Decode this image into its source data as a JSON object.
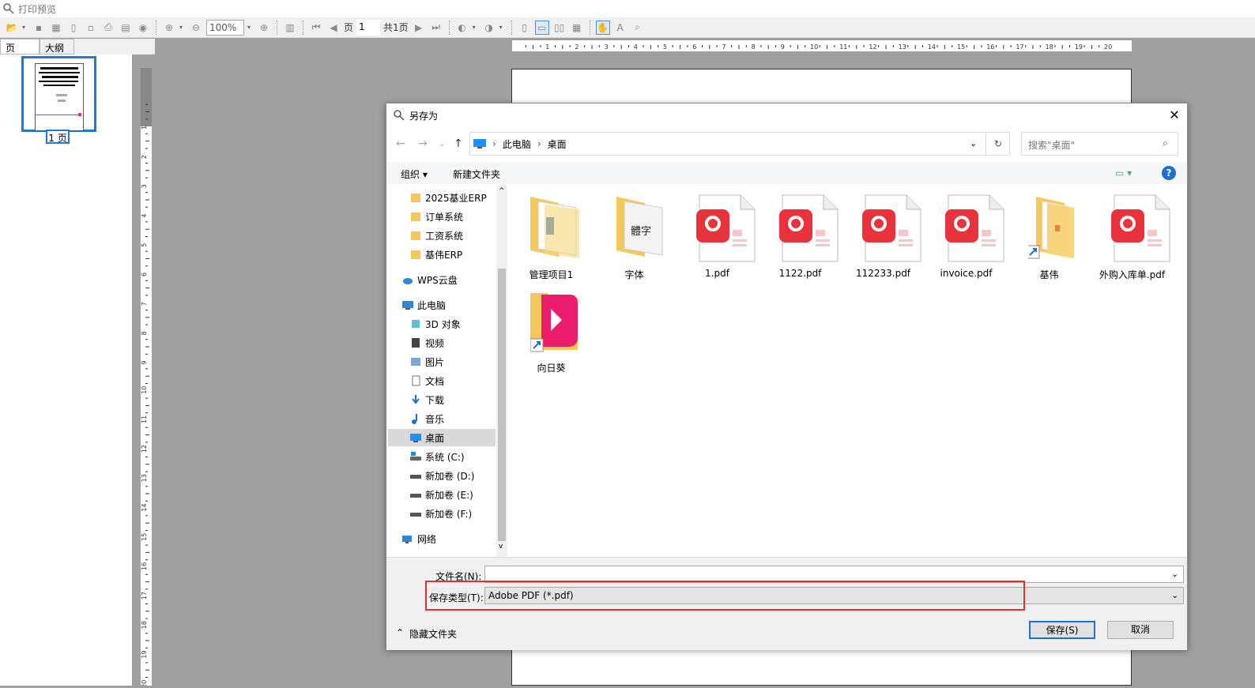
{
  "app": {
    "title": "打印预览"
  },
  "toolbar": {
    "zoom": "100%",
    "page_label": "页",
    "page_value": "1",
    "total_pages": "共1页"
  },
  "left_panel": {
    "tabs": [
      "页",
      "大纲"
    ],
    "thumb_label": "1 页"
  },
  "ruler": {
    "h_ticks": [
      "1",
      "2",
      "3",
      "4",
      "5",
      "6",
      "7",
      "8",
      "9",
      "10",
      "11",
      "12",
      "13",
      "14",
      "15",
      "16",
      "17",
      "18",
      "19",
      "20"
    ],
    "v_ticks": [
      "1",
      "2",
      "3",
      "4",
      "5",
      "6",
      "7",
      "8",
      "9",
      "10",
      "11",
      "12",
      "13",
      "14",
      "15",
      "16",
      "17",
      "18",
      "19",
      "20"
    ]
  },
  "dialog": {
    "title": "另存为",
    "close": "✕",
    "address": {
      "parts": [
        "此电脑",
        "桌面"
      ]
    },
    "search_placeholder": "搜索\"桌面\"",
    "organize": "组织 ▾",
    "new_folder": "新建文件夹",
    "help": "?",
    "tree": [
      {
        "label": "2025基业ERP",
        "icon": "folder-icon"
      },
      {
        "label": "订单系统",
        "icon": "folder-icon"
      },
      {
        "label": "工资系统",
        "icon": "folder-icon"
      },
      {
        "label": "基伟ERP",
        "icon": "folder-icon"
      },
      {
        "label": "WPS云盘",
        "icon": "cloud-icon"
      },
      {
        "label": "此电脑",
        "icon": "computer-icon"
      },
      {
        "label": "3D 对象",
        "icon": "cube-icon"
      },
      {
        "label": "视频",
        "icon": "video-icon"
      },
      {
        "label": "图片",
        "icon": "picture-icon"
      },
      {
        "label": "文档",
        "icon": "document-icon"
      },
      {
        "label": "下载",
        "icon": "download-icon"
      },
      {
        "label": "音乐",
        "icon": "music-icon"
      },
      {
        "label": "桌面",
        "icon": "desktop-icon"
      },
      {
        "label": "系统 (C:)",
        "icon": "drive-c-icon"
      },
      {
        "label": "新加卷 (D:)",
        "icon": "drive-icon"
      },
      {
        "label": "新加卷 (E:)",
        "icon": "drive-icon"
      },
      {
        "label": "新加卷 (F:)",
        "icon": "drive-icon"
      },
      {
        "label": "网络",
        "icon": "network-icon"
      }
    ],
    "files": [
      {
        "name": "管理项目1",
        "type": "folder-doc"
      },
      {
        "name": "字体",
        "type": "folder-font"
      },
      {
        "name": "1.pdf",
        "type": "pdf"
      },
      {
        "name": "1122.pdf",
        "type": "pdf"
      },
      {
        "name": "112233.pdf",
        "type": "pdf"
      },
      {
        "name": "invoice.pdf",
        "type": "pdf"
      },
      {
        "name": "基伟",
        "type": "folder-shortcut"
      },
      {
        "name": "外购入库单.pdf",
        "type": "pdf"
      },
      {
        "name": "向日葵",
        "type": "app-shortcut"
      }
    ],
    "filename_label": "文件名(N):",
    "filename_value": "",
    "filetype_label": "保存类型(T):",
    "filetype_value": "Adobe PDF (*.pdf)",
    "hide_folders": "隐藏文件夹",
    "save_button": "保存(S)",
    "cancel_button": "取消"
  },
  "colors": {
    "accent": "#1e7ad4",
    "pdf_red": "#e8323c",
    "highlight": "#e0312f"
  }
}
